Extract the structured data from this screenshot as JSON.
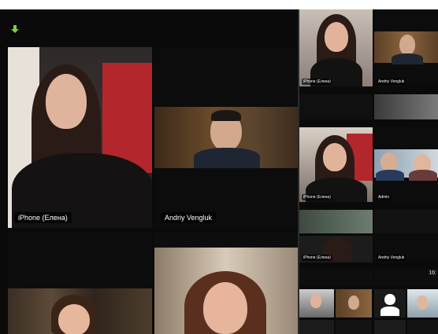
{
  "gallery": {
    "main": [
      {
        "name": "iPhone (Елена)",
        "active": true
      },
      {
        "name": "Andriy Vengluk",
        "active": false
      },
      {
        "name": "",
        "active": false
      },
      {
        "name": "",
        "active": false
      }
    ],
    "side": [
      {
        "name": "iPhone (Елена)"
      },
      {
        "name": "Andriy Vengluk"
      },
      {
        "name": ""
      },
      {
        "name": ""
      },
      {
        "name": "iPhone (Елена)"
      },
      {
        "name": "Admin"
      },
      {
        "name": ""
      },
      {
        "name": ""
      },
      {
        "name": "iPhone (Елена)"
      },
      {
        "name": "Andriy Vengluk"
      },
      {
        "name": ""
      },
      {
        "name": "16:"
      }
    ]
  },
  "colors": {
    "active_border": "#6bd46f",
    "background": "#0a0a0a",
    "arrow": "#7ad13a"
  },
  "icons": {
    "top_left": "arrow-down-icon"
  }
}
